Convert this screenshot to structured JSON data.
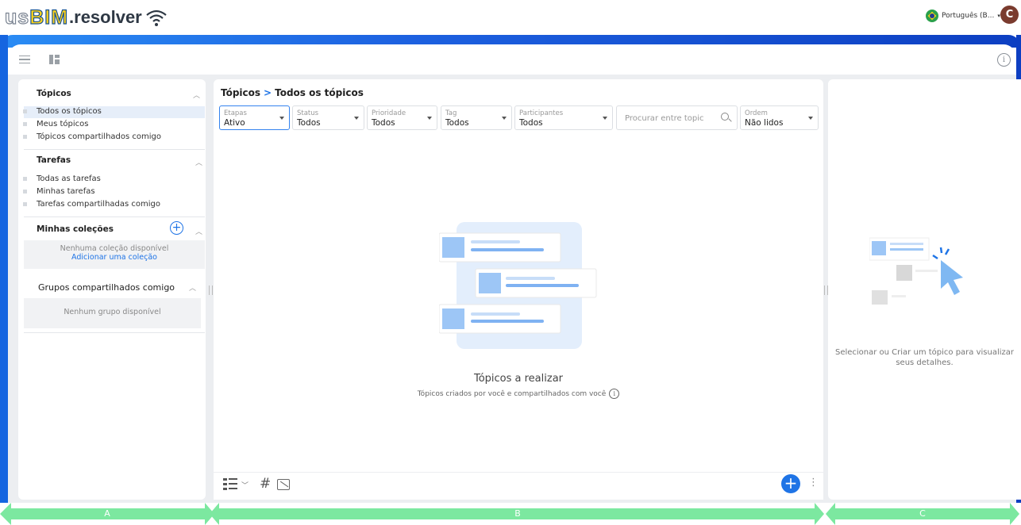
{
  "app": {
    "logo_us": "us",
    "logo_bim": "BIM",
    "logo_resolver": ".resolver"
  },
  "header": {
    "language": "Português (B...",
    "avatar_initial": "C"
  },
  "sidebar": {
    "topics": {
      "title": "Tópicos",
      "items": [
        "Todos os tópicos",
        "Meus tópicos",
        "Tópicos compartilhados comigo"
      ]
    },
    "tasks": {
      "title": "Tarefas",
      "items": [
        "Todas as tarefas",
        "Minhas tarefas",
        "Tarefas compartilhadas comigo"
      ]
    },
    "collections": {
      "title": "Minhas coleções",
      "empty": "Nenhuma coleção disponível",
      "add_link": "Adicionar uma coleção"
    },
    "groups": {
      "title": "Grupos compartilhados comigo",
      "empty": "Nenhum grupo disponível"
    }
  },
  "main": {
    "breadcrumb": {
      "root": "Tópicos",
      "separator": ">",
      "current": "Todos os tópicos"
    },
    "filters": [
      {
        "label": "Etapas",
        "value": "Ativo"
      },
      {
        "label": "Status",
        "value": "Todos"
      },
      {
        "label": "Prioridade",
        "value": "Todos"
      },
      {
        "label": "Tag",
        "value": "Todos"
      },
      {
        "label": "Participantes",
        "value": "Todos"
      }
    ],
    "search_placeholder": "Procurar entre topic",
    "order": {
      "label": "Ordem",
      "value": "Não lidos"
    },
    "empty_title": "Tópicos a realizar",
    "empty_subtitle": "Tópicos criados por você e compartilhados com você"
  },
  "detail": {
    "message": "Selecionar ou Criar um tópico para visualizar seus detalhes."
  },
  "bands": [
    "A",
    "B",
    "C"
  ],
  "colors": {
    "accent": "#1f74e6",
    "band": "#7ce8a0",
    "frame": "#1565e0"
  }
}
